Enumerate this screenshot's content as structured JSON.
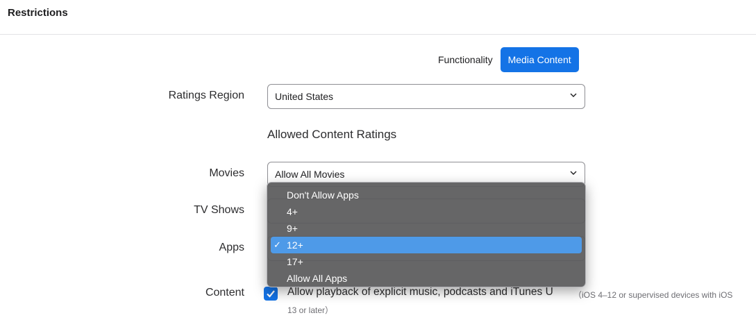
{
  "header": {
    "title": "Restrictions"
  },
  "segmented": {
    "tabs": [
      {
        "label": "Functionality"
      },
      {
        "label": "Media Content"
      }
    ],
    "active": "Media Content"
  },
  "ratings_region": {
    "label": "Ratings Region",
    "value": "United States"
  },
  "allowed_ratings": {
    "title": "Allowed Content Ratings",
    "movies": {
      "label": "Movies",
      "value": "Allow All Movies"
    },
    "tv_shows": {
      "label": "TV Shows"
    },
    "apps": {
      "label": "Apps"
    }
  },
  "apps_menu": {
    "items": [
      "Don't Allow Apps",
      "4+",
      "9+",
      "12+",
      "17+",
      "Allow All Apps"
    ],
    "selected": "12+",
    "check_glyph": "✓"
  },
  "content": {
    "label": "Content",
    "checkbox_checked": true,
    "text": "Allow playback of explicit music, podcasts and iTunes U",
    "note_line1": "（iOS 4–12 or supervised devices with iOS",
    "note_line2": "13 or later）"
  },
  "colors": {
    "accent": "#1473e6",
    "menu_highlight": "#4e9ae8",
    "menu_bg": "#5c5c5e"
  }
}
